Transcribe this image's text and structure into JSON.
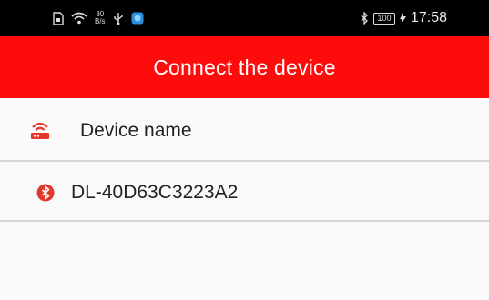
{
  "status_bar": {
    "net_speed_value": "80",
    "net_speed_unit": "B/s",
    "battery_level": "100",
    "time": "17:58"
  },
  "header": {
    "title": "Connect the device"
  },
  "list": {
    "header_label": "Device name",
    "devices": [
      {
        "name": "DL-40D63C3223A2",
        "icon": "bluetooth-icon"
      }
    ]
  },
  "colors": {
    "accent": "#fe0b0b",
    "status_bar_bg": "#000000",
    "background": "#fafafa",
    "divider": "#d7d7d7"
  }
}
